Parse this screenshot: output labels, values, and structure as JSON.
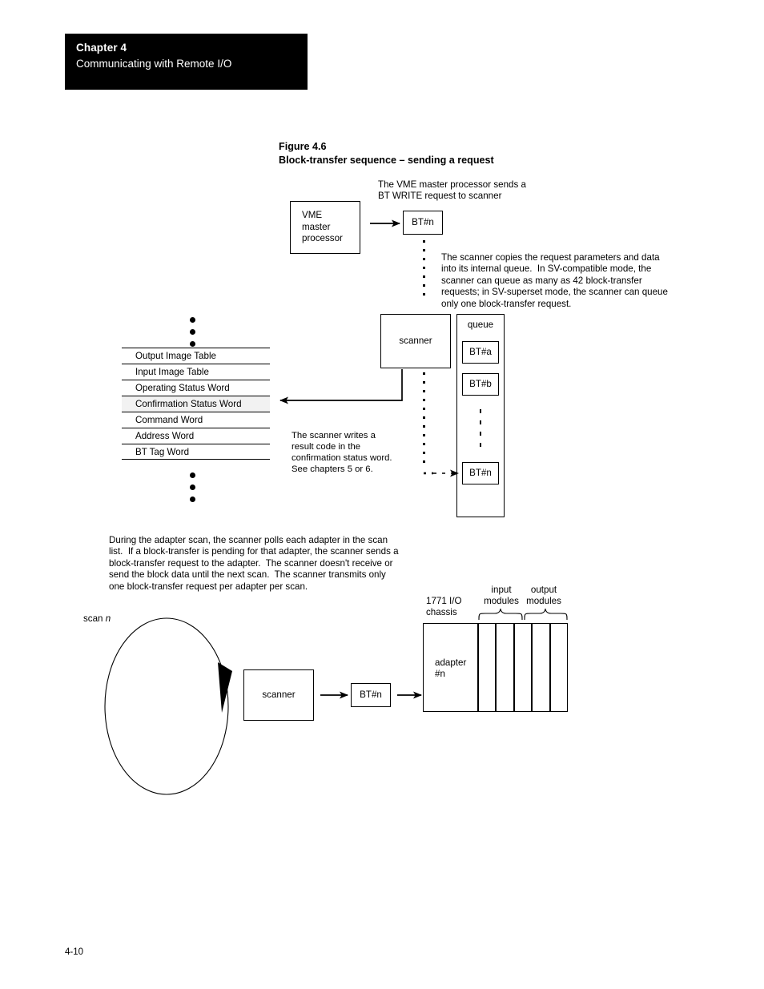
{
  "header": {
    "chapter_label": "Chapter  4",
    "chapter_subtitle": "Communicating with Remote I/O"
  },
  "figure": {
    "number": "Figure 4.6",
    "title": "Block-transfer sequence –  sending a request"
  },
  "annotations": {
    "vme_note": "The VME master processor sends a\nBT WRITE request to scanner",
    "queue_note": "The scanner copies the request parameters and data\ninto its internal queue.  In SV-compatible mode, the\nscanner can queue as many as 42 block-transfer\nrequests; in SV-superset mode, the scanner can queue\nonly one block-transfer request.",
    "result_note": "The scanner writes a\nresult code in the\nconfirmation status word.\nSee chapters 5 or 6.",
    "scan_note": "During the adapter scan, the scanner polls each adapter in the scan\nlist.  If a block-transfer is pending for that adapter, the scanner sends a\nblock-transfer request to the adapter.  The scanner doesn't receive or\nsend the block data until the next scan.  The scanner transmits only\none block-transfer request per adapter per scan."
  },
  "top_diagram": {
    "vme_box": "VME\nmaster\nprocessor",
    "bt_request": "BT#n",
    "scanner_box": "scanner",
    "queue_label": "queue",
    "queue_items": [
      "BT#a",
      "BT#b",
      "BT#n"
    ],
    "image_table_rows": [
      "Output Image Table",
      "Input Image Table",
      "Operating Status Word",
      "Confirmation Status Word",
      "Command Word",
      "Address Word",
      "BT Tag Word"
    ],
    "highlighted_row_index": 3
  },
  "bottom_diagram": {
    "scan_label_prefix": "scan ",
    "scan_label_italic": "n",
    "scanner_box": "scanner",
    "bt_request": "BT#n",
    "chassis_label": "1771 I/O\nchassis",
    "adapter_label": "adapter\n#n",
    "input_modules_label": "input\nmodules",
    "output_modules_label": "output\nmodules"
  },
  "footer": {
    "page_number": "4-10"
  }
}
